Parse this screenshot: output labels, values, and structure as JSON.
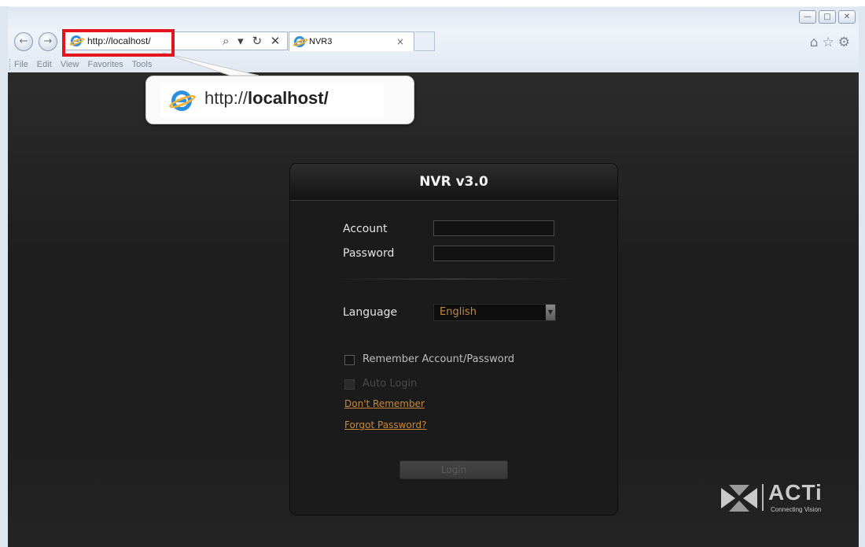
{
  "window": {
    "minimize": "—",
    "maximize": "□",
    "close": "✕"
  },
  "browser": {
    "address_url": "http://localhost/",
    "address_tools": "⌕ ▾ ↻ ✕",
    "tab_title": "NVR3",
    "tab_close": "×",
    "right_icons": "⌂☆⚙",
    "menu": [
      "File",
      "Edit",
      "View",
      "Favorites",
      "Tools"
    ]
  },
  "callout": {
    "url_prefix": "http://",
    "url_host": "localhost/"
  },
  "login": {
    "title": "NVR v3.0",
    "account_label": "Account",
    "password_label": "Password",
    "language_label": "Language",
    "language_value": "English",
    "remember_label": "Remember Account/Password",
    "auto_login_label": "Auto Login",
    "dont_remember_link": "Don't Remember",
    "forgot_password_link": "Forgot Password?",
    "login_button": "Login"
  },
  "brand": {
    "name": "ACTi",
    "tagline": "Connecting Vision"
  },
  "colors": {
    "accent_orange": "#c8873a",
    "highlight_red": "#e3141b",
    "ie_blue": "#2d8fe0"
  }
}
